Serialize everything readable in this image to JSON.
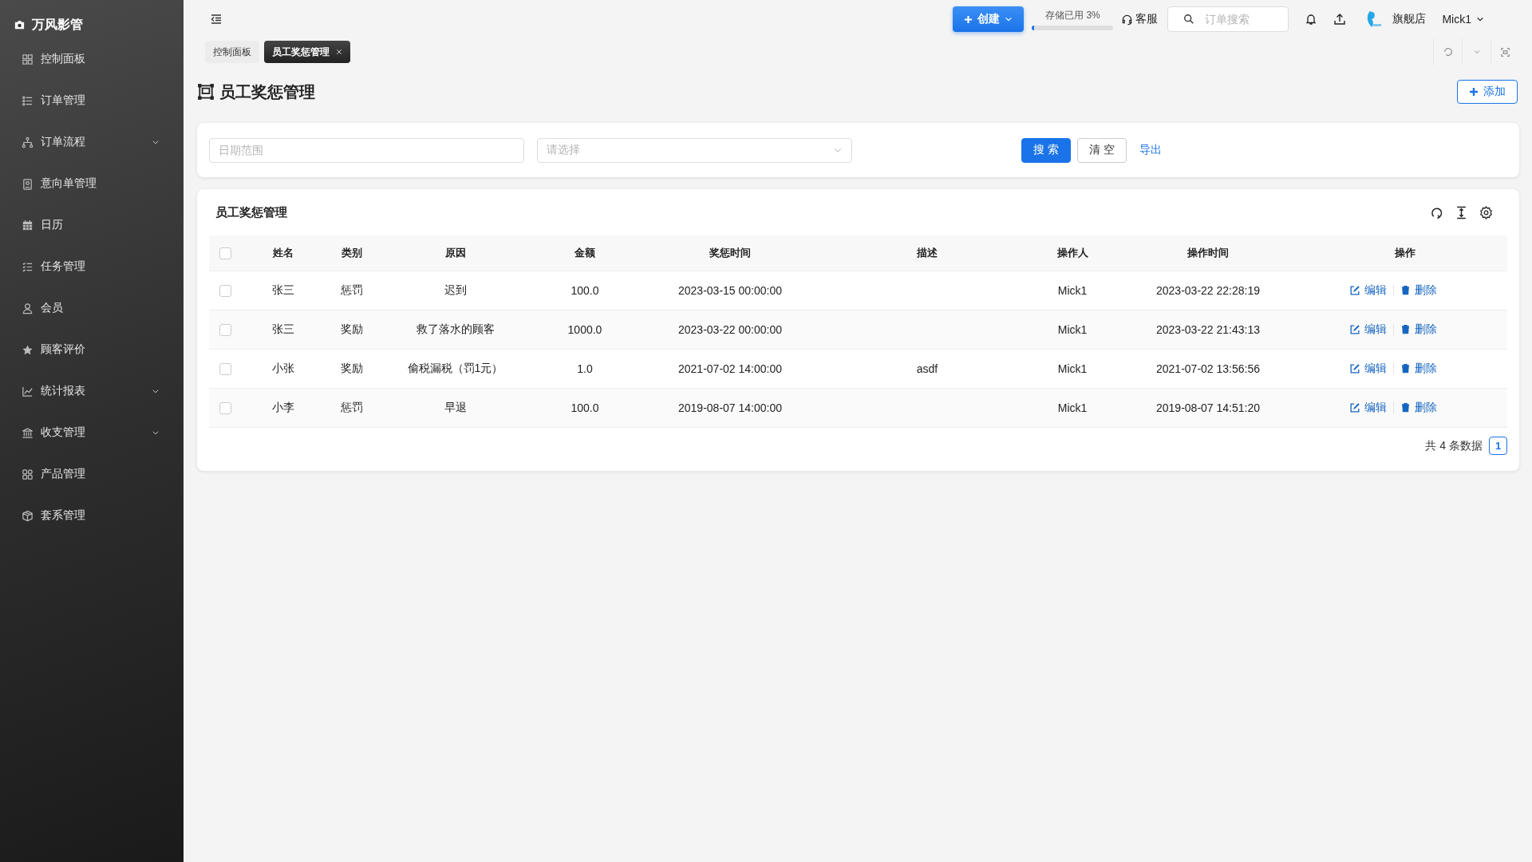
{
  "sidebar": {
    "brand": "万风影管",
    "items": [
      {
        "label": "控制面板",
        "expandable": false
      },
      {
        "label": "订单管理",
        "expandable": false
      },
      {
        "label": "订单流程",
        "expandable": true
      },
      {
        "label": "意向单管理",
        "expandable": false
      },
      {
        "label": "日历",
        "expandable": false
      },
      {
        "label": "任务管理",
        "expandable": false
      },
      {
        "label": "会员",
        "expandable": false
      },
      {
        "label": "顾客评价",
        "expandable": false
      },
      {
        "label": "统计报表",
        "expandable": true
      },
      {
        "label": "收支管理",
        "expandable": true
      },
      {
        "label": "产品管理",
        "expandable": false
      },
      {
        "label": "套系管理",
        "expandable": false
      }
    ]
  },
  "topbar": {
    "create_button": "创建",
    "storage": {
      "label": "存储已用 3%",
      "level": 0.03
    },
    "support": "客服",
    "search": {
      "placeholder": "订单搜索"
    },
    "shop": "旗舰店",
    "user": "Mick1"
  },
  "tabs": [
    {
      "label": "控制面板",
      "selected": false,
      "closable": false
    },
    {
      "label": "员工奖惩管理",
      "selected": true,
      "closable": true
    }
  ],
  "page": {
    "title": "员工奖惩管理",
    "add_button": "添加"
  },
  "filters": {
    "date_range": {
      "placeholder": "日期范围"
    },
    "select": {
      "placeholder": "请选择"
    },
    "search_button": "搜 索",
    "clear_button": "清 空",
    "export_link": "导出"
  },
  "table": {
    "title": "员工奖惩管理",
    "header_checked": false,
    "columns": [
      "姓名",
      "类别",
      "原因",
      "金额",
      "奖惩时间",
      "描述",
      "操作人",
      "操作时间",
      "操作"
    ],
    "rows": [
      {
        "checked": false,
        "cells": [
          "张三",
          "惩罚",
          "迟到",
          "100.0",
          "2023-03-15 00:00:00",
          "",
          "Mick1",
          "2023-03-22 22:28:19"
        ],
        "actions": [
          "编辑",
          "删除"
        ]
      },
      {
        "checked": false,
        "cells": [
          "张三",
          "奖励",
          "救了落水的顾客",
          "1000.0",
          "2023-03-22 00:00:00",
          "",
          "Mick1",
          "2023-03-22 21:43:13"
        ],
        "actions": [
          "编辑",
          "删除"
        ]
      },
      {
        "checked": false,
        "cells": [
          "小张",
          "奖励",
          "偷税漏税（罚1元）",
          "1.0",
          "2021-07-02 14:00:00",
          "asdf",
          "Mick1",
          "2021-07-02 13:56:56"
        ],
        "actions": [
          "编辑",
          "删除"
        ]
      },
      {
        "checked": false,
        "cells": [
          "小李",
          "惩罚",
          "早退",
          "100.0",
          "2019-08-07 14:00:00",
          "",
          "Mick1",
          "2019-08-07 14:51:20"
        ],
        "actions": [
          "编辑",
          "删除"
        ]
      }
    ],
    "total": "共 4 条数据",
    "pages": [
      {
        "label": "1",
        "selected": true
      }
    ]
  }
}
